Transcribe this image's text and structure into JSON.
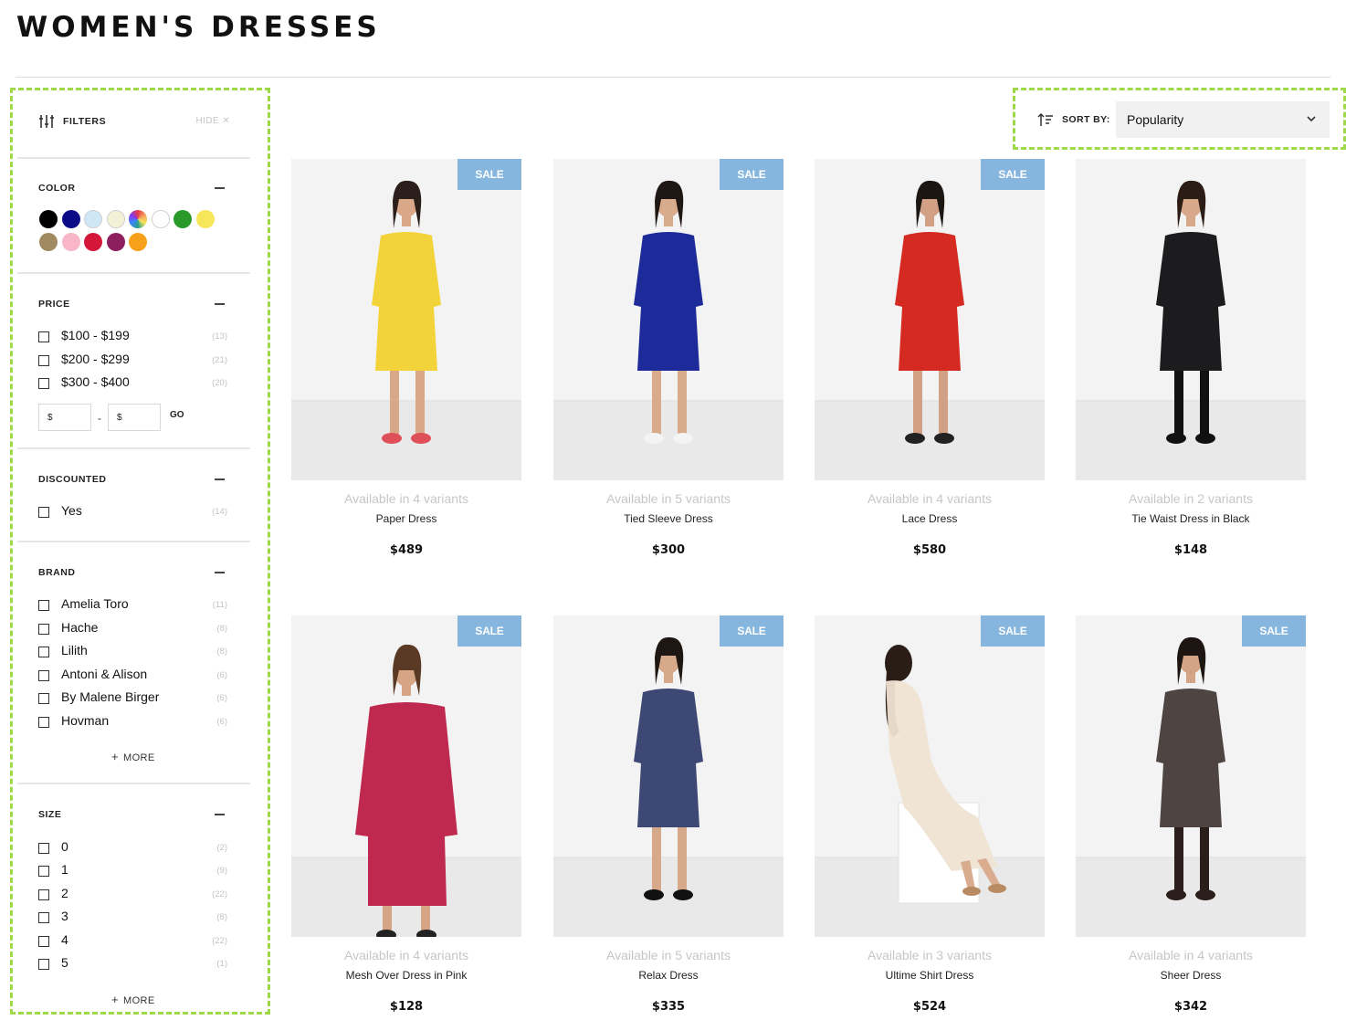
{
  "page": {
    "title": "WOMEN'S DRESSES"
  },
  "filters": {
    "header_label": "FILTERS",
    "hide_label": "HIDE",
    "color": {
      "title": "COLOR",
      "swatches": [
        "#000000",
        "#0b0b87",
        "#cfe8f7",
        "#f3f0d8",
        "multicolor",
        "#ffffff",
        "#2b9a2b",
        "#f7e65a",
        "#a08a62",
        "#f8b6c8",
        "#d4163b",
        "#8e1f5e",
        "#f7a11a"
      ]
    },
    "price": {
      "title": "PRICE",
      "options": [
        {
          "label": "$100 - $199",
          "count": "(13)"
        },
        {
          "label": "$200 - $299",
          "count": "(21)"
        },
        {
          "label": "$300 - $400",
          "count": "(20)"
        }
      ],
      "min_placeholder": "$",
      "max_placeholder": "$",
      "dash": "-",
      "go_label": "GO"
    },
    "discounted": {
      "title": "DISCOUNTED",
      "options": [
        {
          "label": "Yes",
          "count": "(14)"
        }
      ]
    },
    "brand": {
      "title": "BRAND",
      "options": [
        {
          "label": "Amelia Toro",
          "count": "(11)"
        },
        {
          "label": "Hache",
          "count": "(8)"
        },
        {
          "label": "Lilith",
          "count": "(8)"
        },
        {
          "label": "Antoni & Alison",
          "count": "(6)"
        },
        {
          "label": "By Malene Birger",
          "count": "(6)"
        },
        {
          "label": "Hovman",
          "count": "(6)"
        }
      ],
      "more_label": "MORE"
    },
    "size": {
      "title": "SIZE",
      "options": [
        {
          "label": "0",
          "count": "(2)"
        },
        {
          "label": "1",
          "count": "(9)"
        },
        {
          "label": "2",
          "count": "(22)"
        },
        {
          "label": "3",
          "count": "(8)"
        },
        {
          "label": "4",
          "count": "(22)"
        },
        {
          "label": "5",
          "count": "(1)"
        }
      ],
      "more_label": "MORE"
    }
  },
  "sort": {
    "label": "SORT BY:",
    "selected": "Popularity"
  },
  "products": [
    {
      "variants": "Available in 4 variants",
      "name": "Paper Dress",
      "price": "$489",
      "sale": "SALE",
      "dress_color": "#f2d43a",
      "skin": "#d9a888",
      "hair": "#2a1f1a",
      "shoes": "#e0505a"
    },
    {
      "variants": "Available in 5 variants",
      "name": "Tied Sleeve Dress",
      "price": "$300",
      "sale": "SALE",
      "dress_color": "#1c2a9a",
      "skin": "#d8ab8c",
      "hair": "#1e1714",
      "shoes": "#f4f4f4"
    },
    {
      "variants": "Available in 4 variants",
      "name": "Lace Dress",
      "price": "$580",
      "sale": "SALE",
      "dress_color": "#d42a22",
      "skin": "#d2a085",
      "hair": "#1c1613",
      "shoes": "#222222"
    },
    {
      "variants": "Available in 2 variants",
      "name": "Tie Waist Dress in Black",
      "price": "$148",
      "sale": "",
      "dress_color": "#1c1c1e",
      "skin": "#d7a88a",
      "hair": "#2b1d16",
      "shoes": "#111111"
    },
    {
      "variants": "Available in 4 variants",
      "name": "Mesh Over Dress in Pink",
      "price": "$128",
      "sale": "SALE",
      "dress_color": "#c0294f",
      "skin": "#d6a585",
      "hair": "#5a3a24",
      "shoes": "#222222"
    },
    {
      "variants": "Available in 5 variants",
      "name": "Relax Dress",
      "price": "$335",
      "sale": "SALE",
      "dress_color": "#3e4874",
      "skin": "#d7a98b",
      "hair": "#1d1613",
      "shoes": "#111111"
    },
    {
      "variants": "Available in 3 variants",
      "name": "Ultime Shirt Dress",
      "price": "$524",
      "sale": "SALE",
      "dress_color": "#efe3d2",
      "skin": "#d9ac8f",
      "hair": "#2a1d16",
      "shoes": "#b98b63"
    },
    {
      "variants": "Available in 4 variants",
      "name": "Sheer Dress",
      "price": "$342",
      "sale": "SALE",
      "dress_color": "#4e4542",
      "skin": "#d4a487",
      "hair": "#1c1512",
      "shoes": "#2a1e1a"
    }
  ]
}
